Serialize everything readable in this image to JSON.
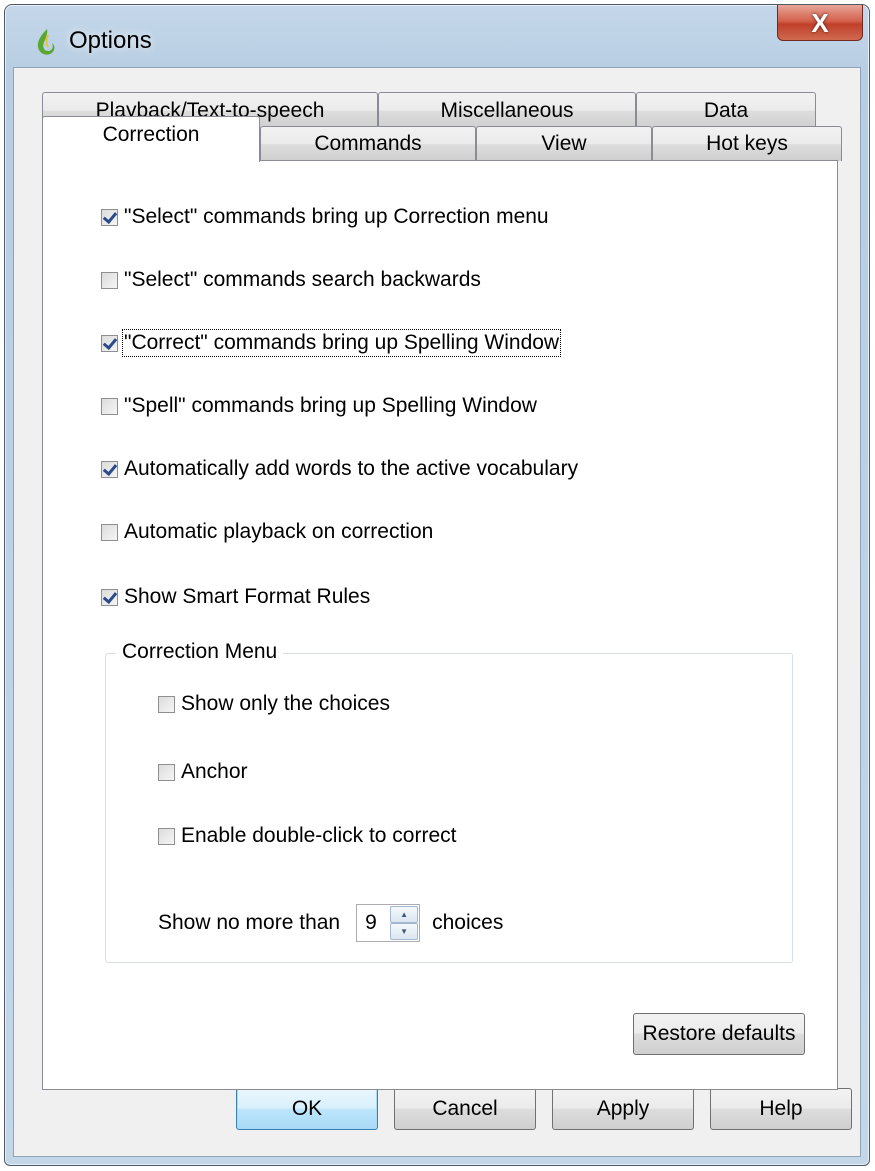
{
  "window": {
    "title": "Options",
    "close_glyph": "X",
    "icon": "dragon-flame-icon",
    "accent_colors": {
      "titlebar": "#b7cde2",
      "close": "#c0402b",
      "check": "#2b4a8a"
    }
  },
  "tabs": {
    "row1": [
      {
        "label": "Playback/Text-to-speech"
      },
      {
        "label": "Miscellaneous"
      },
      {
        "label": "Data"
      }
    ],
    "row2": [
      {
        "label": "Correction",
        "selected": true
      },
      {
        "label": "Commands"
      },
      {
        "label": "View"
      },
      {
        "label": "Hot keys"
      }
    ]
  },
  "options": [
    {
      "label": "\"Select\" commands bring up Correction menu",
      "checked": true
    },
    {
      "label": "\"Select\" commands search backwards",
      "checked": false
    },
    {
      "label": "\"Correct\" commands bring up Spelling Window",
      "checked": true
    },
    {
      "label": "\"Spell\" commands bring up Spelling Window",
      "checked": false
    },
    {
      "label": "Automatically add words to the active vocabulary",
      "checked": true
    },
    {
      "label": "Automatic playback on correction",
      "checked": false
    },
    {
      "label": "Show Smart Format Rules",
      "checked": true
    }
  ],
  "correction_menu": {
    "title": "Correction Menu",
    "options": [
      {
        "label": "Show only the choices",
        "checked": false
      },
      {
        "label": "Anchor",
        "checked": false
      },
      {
        "label": "Enable double-click to correct",
        "checked": false
      }
    ],
    "max_choices": {
      "prefix": "Show no more than",
      "value": "9",
      "suffix": "choices"
    }
  },
  "buttons": {
    "restore": "Restore defaults",
    "ok": "OK",
    "cancel": "Cancel",
    "apply": "Apply",
    "help": "Help"
  }
}
